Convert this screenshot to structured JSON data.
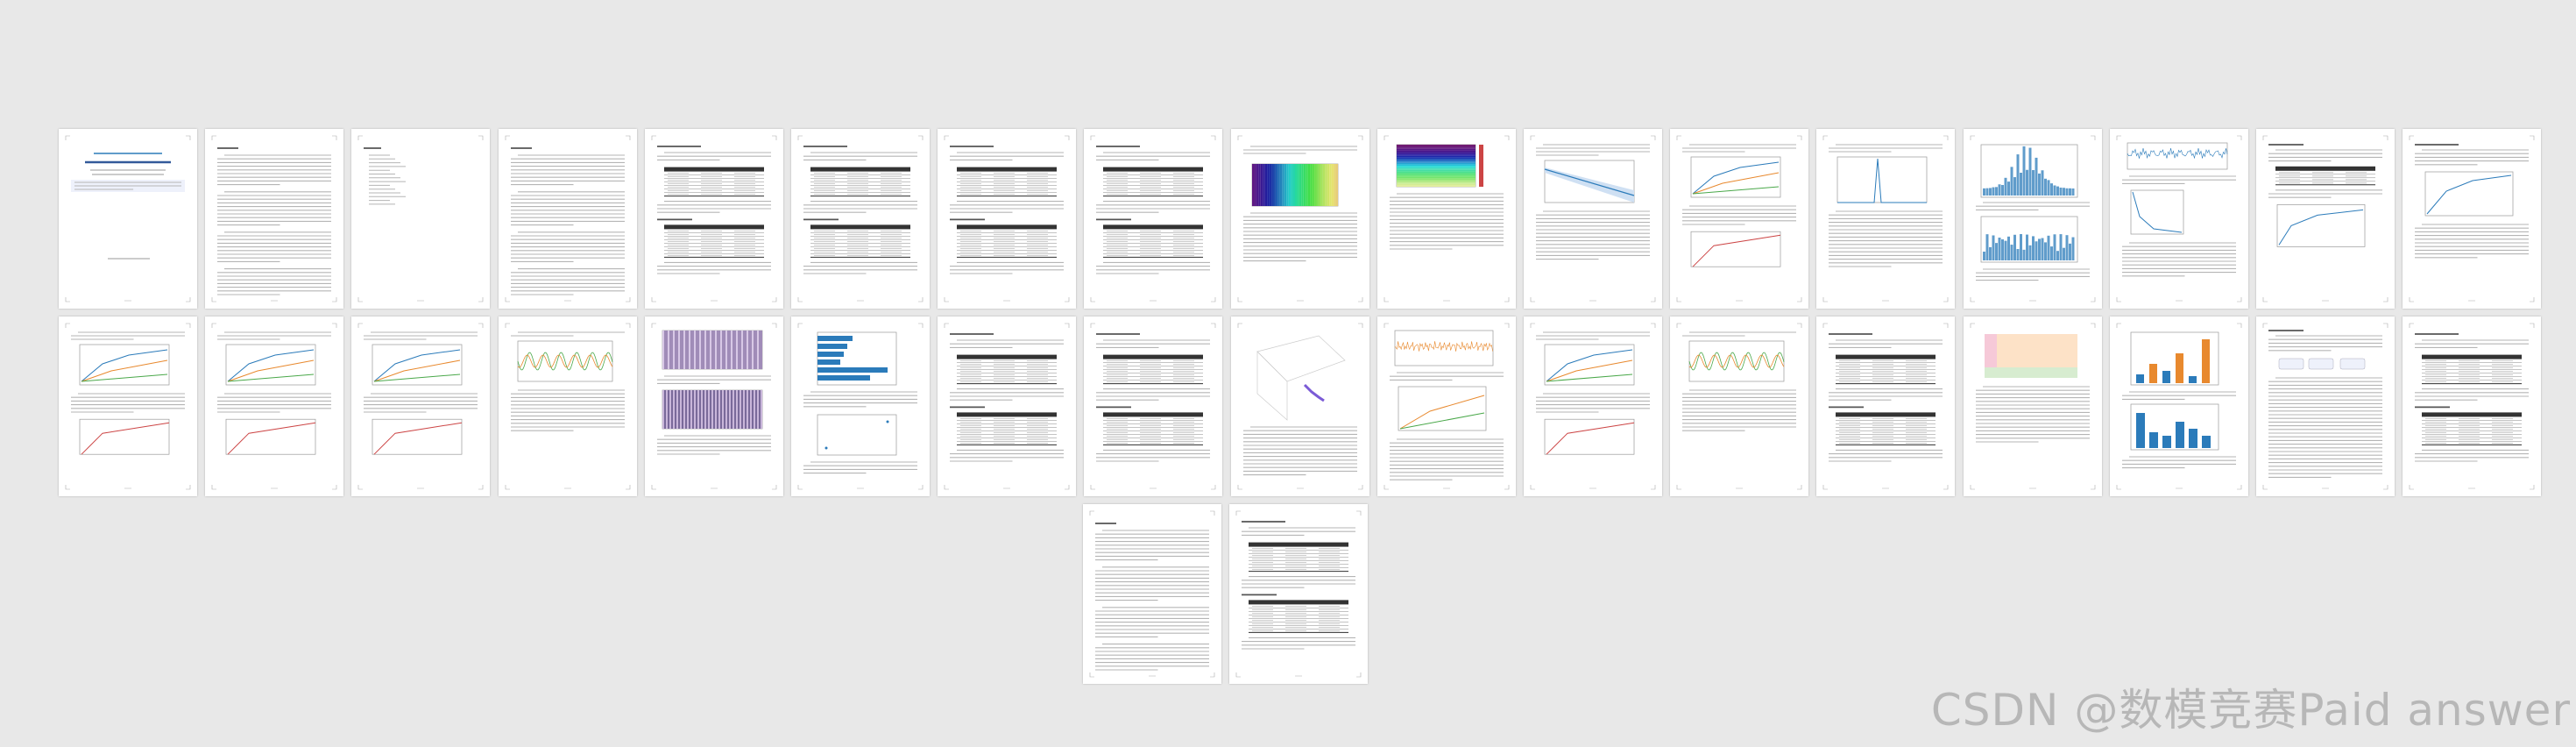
{
  "viewer": {
    "watermark": "CSDN @数模竞赛Paid answer",
    "page_layouts": [
      "title",
      "text",
      "toc",
      "text",
      "tables",
      "tables",
      "tables",
      "tables",
      "heatmap",
      "colormap",
      "lineband",
      "curves",
      "spike",
      "histograms",
      "noise",
      "tablecurve",
      "curve",
      "curves",
      "curves",
      "curves",
      "signal",
      "stripes",
      "bars",
      "tables",
      "tables",
      "scatter3d",
      "noiseline",
      "curves",
      "signal",
      "tables",
      "region",
      "bargraph",
      "flowchart",
      "tables",
      "text",
      "tables"
    ]
  },
  "colors": {
    "background": "#e8e8e8",
    "page": "#ffffff",
    "text_line": "#b5b5b5",
    "heading": "#555555",
    "chart_blue": "#2b7bba",
    "chart_orange": "#e8892e",
    "chart_green": "#4aa84a"
  }
}
